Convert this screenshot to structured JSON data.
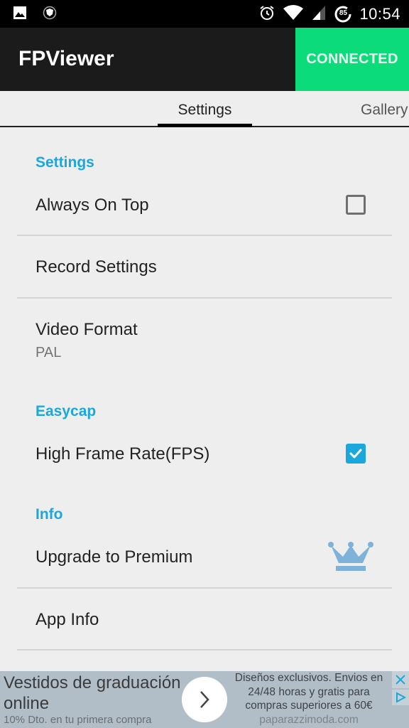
{
  "status_bar": {
    "time": "10:54",
    "battery_level": "85",
    "icons": [
      "gallery-notification-icon",
      "shield-notification-icon",
      "alarm-icon",
      "wifi-icon",
      "cell-signal-icon",
      "battery-icon"
    ]
  },
  "app_bar": {
    "title": "FPViewer",
    "connection_button": "CONNECTED",
    "connection_color": "#0bdc79"
  },
  "tabs": [
    {
      "label": "Settings",
      "active": true
    },
    {
      "label": "Gallery",
      "active": false
    }
  ],
  "sections": [
    {
      "header": "Settings",
      "items": [
        {
          "title": "Always On Top",
          "type": "checkbox",
          "checked": false
        },
        {
          "title": "Record Settings",
          "type": "link"
        },
        {
          "title": "Video Format",
          "summary": "PAL",
          "type": "list"
        }
      ]
    },
    {
      "header": "Easycap",
      "items": [
        {
          "title": "High Frame Rate(FPS)",
          "type": "checkbox",
          "checked": true
        }
      ]
    },
    {
      "header": "Info",
      "items": [
        {
          "title": "Upgrade to Premium",
          "type": "link",
          "icon": "crown-icon"
        },
        {
          "title": "App Info",
          "type": "link"
        }
      ]
    }
  ],
  "accent_color": "#1aa7dc",
  "ad": {
    "headline": "Vestidos de graduación online",
    "subline": "10% Dto. en tu primera compra",
    "description": "Diseños exclusivos. Envios en 24/48 horas y gratis para compras superiores a 60€",
    "url": "paparazzimoda.com"
  }
}
